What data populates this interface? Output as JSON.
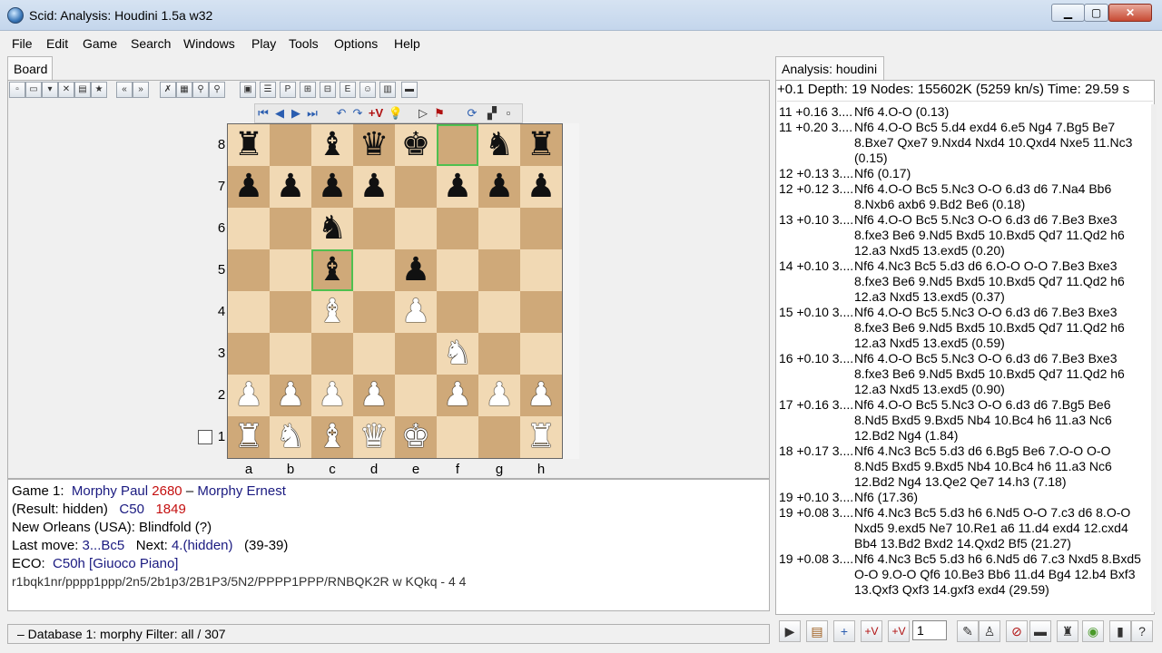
{
  "window": {
    "title": "Scid: Analysis: Houdini 1.5a w32"
  },
  "menu": [
    "File",
    "Edit",
    "Game",
    "Search",
    "Windows",
    "Play",
    "Tools",
    "Options",
    "Help"
  ],
  "board_tab": "Board",
  "analysis_tab": "Analysis: houdini",
  "board": {
    "ranks": [
      "8",
      "7",
      "6",
      "5",
      "4",
      "3",
      "2",
      "1"
    ],
    "files": [
      "a",
      "b",
      "c",
      "d",
      "e",
      "f",
      "g",
      "h"
    ],
    "fen_rows": [
      "r1bqk1nr",
      "pppp1ppp",
      "2n5",
      "2b1p3",
      "2B1P3",
      "5N2",
      "PPPP1PPP",
      "RNBQK2R"
    ],
    "highlight": [
      "f8",
      "c5"
    ]
  },
  "game": {
    "line1_label": "Game 1:",
    "white": "Morphy Paul",
    "white_elo": "2680",
    "dash": "–",
    "black": "Morphy Ernest",
    "result": "(Result: hidden)",
    "eco": "C50",
    "year": "1849",
    "site": "New Orleans (USA):  Blindfold (?)",
    "last_move_label": "Last move:",
    "last_move": "3...Bc5",
    "next_label": "Next:",
    "next": "4.(hidden)",
    "ply": "(39-39)",
    "eco_label": "ECO:",
    "eco_full": "C50h [Giuoco Piano]",
    "fen": "r1bqk1nr/pppp1ppp/2n5/2b1p3/2B1P3/5N2/PPPP1PPP/RNBQK2R w KQkq - 4 4"
  },
  "status": "–  Database 1: morphy   Filter: all / 307",
  "analysis": {
    "header": "+0.1 Depth: 19 Nodes: 155602K (5259 kn/s) Time:  29.59 s",
    "lines": [
      {
        "hd": "11 +0.16 3....",
        "mv": "Nf6 4.O-O  (0.13)"
      },
      {
        "hd": "11 +0.20 3....",
        "mv": "Nf6 4.O-O Bc5 5.d4 exd4 6.e5 Ng4 7.Bg5 Be7 8.Bxe7 Qxe7 9.Nxd4 Nxd4 10.Qxd4 Nxe5 11.Nc3 (0.15)"
      },
      {
        "hd": "12 +0.13 3....",
        "mv": "Nf6  (0.17)"
      },
      {
        "hd": "12 +0.12 3....",
        "mv": "Nf6 4.O-O Bc5 5.Nc3 O-O 6.d3 d6 7.Na4 Bb6 8.Nxb6 axb6 9.Bd2 Be6  (0.18)"
      },
      {
        "hd": "13 +0.10 3....",
        "mv": "Nf6 4.O-O Bc5 5.Nc3 O-O 6.d3 d6 7.Be3 Bxe3 8.fxe3 Be6 9.Nd5 Bxd5 10.Bxd5 Qd7 11.Qd2 h6 12.a3 Nxd5 13.exd5  (0.20)"
      },
      {
        "hd": "14 +0.10 3....",
        "mv": "Nf6 4.Nc3 Bc5 5.d3 d6 6.O-O O-O 7.Be3 Bxe3 8.fxe3 Be6 9.Nd5 Bxd5 10.Bxd5 Qd7 11.Qd2 h6 12.a3 Nxd5 13.exd5  (0.37)"
      },
      {
        "hd": "15 +0.10 3....",
        "mv": "Nf6 4.O-O Bc5 5.Nc3 O-O 6.d3 d6 7.Be3 Bxe3 8.fxe3 Be6 9.Nd5 Bxd5 10.Bxd5 Qd7 11.Qd2 h6 12.a3 Nxd5 13.exd5  (0.59)"
      },
      {
        "hd": "16 +0.10 3....",
        "mv": "Nf6 4.O-O Bc5 5.Nc3 O-O 6.d3 d6 7.Be3 Bxe3 8.fxe3 Be6 9.Nd5 Bxd5 10.Bxd5 Qd7 11.Qd2 h6 12.a3 Nxd5 13.exd5  (0.90)"
      },
      {
        "hd": "17 +0.16 3....",
        "mv": "Nf6 4.O-O Bc5 5.Nc3 O-O 6.d3 d6 7.Bg5 Be6 8.Nd5 Bxd5 9.Bxd5 Nb4 10.Bc4 h6 11.a3 Nc6 12.Bd2 Ng4  (1.84)"
      },
      {
        "hd": "18 +0.17 3....",
        "mv": "Nf6 4.Nc3 Bc5 5.d3 d6 6.Bg5 Be6 7.O-O O-O 8.Nd5 Bxd5 9.Bxd5 Nb4 10.Bc4 h6 11.a3 Nc6 12.Bd2 Ng4 13.Qe2 Qe7 14.h3  (7.18)"
      },
      {
        "hd": "19 +0.10 3....",
        "mv": "Nf6  (17.36)"
      },
      {
        "hd": "19 +0.08 3....",
        "mv": "Nf6 4.Nc3 Bc5 5.d3 h6 6.Nd5 O-O 7.c3 d6 8.O-O Nxd5 9.exd5 Ne7 10.Re1 a6 11.d4 exd4 12.cxd4 Bb4 13.Bd2 Bxd2 14.Qxd2 Bf5  (21.27)"
      },
      {
        "hd": "19 +0.08 3....",
        "mv": "Nf6 4.Nc3 Bc5 5.d3 h6 6.Nd5 d6 7.c3 Nxd5 8.Bxd5 O-O 9.O-O Qf6 10.Be3 Bb6 11.d4 Bg4 12.b4 Bxf3 13.Qxf3 Qxf3 14.gxf3 exd4  (29.59)"
      }
    ],
    "multipv": "1"
  },
  "icons": {
    "board_toolbar": [
      "new-icon",
      "open-icon",
      "save-icon",
      "close-db-icon",
      "folder-icon",
      "bookmark-icon",
      "back-icon",
      "forward-icon",
      "delete-icon",
      "filter-icon",
      "search-icon",
      "search2-icon",
      "window1-icon",
      "list-icon",
      "pgn-icon",
      "tree-icon",
      "crosstable-icon",
      "eco-icon",
      "player-icon",
      "stats-icon",
      "bus-icon"
    ],
    "nav": [
      "start-icon",
      "prev-icon",
      "next-icon",
      "end-icon",
      "var-back-icon",
      "var-fwd-icon",
      "add-var-icon",
      "bulb-icon",
      "play-icon",
      "flag-icon",
      "flip-icon",
      "coords-icon",
      "extra-icon"
    ],
    "analysis_toolbar": [
      "start-engine-icon",
      "clipboard-icon",
      "add-line-icon",
      "add-var-icon",
      "add-all-icon",
      "edit-icon",
      "annotate-icon",
      "stop-icon",
      "train-icon",
      "info-icon",
      "lock-icon",
      "finish-icon",
      "help-icon"
    ]
  }
}
